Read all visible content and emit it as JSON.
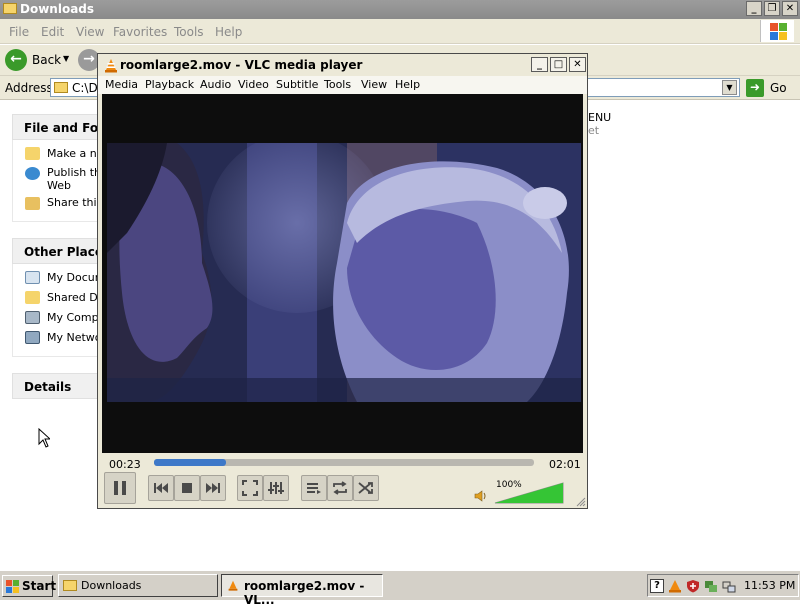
{
  "explorer": {
    "title": "Downloads",
    "menu": [
      "File",
      "Edit",
      "View",
      "Favorites",
      "Tools",
      "Help"
    ],
    "toolbar": {
      "back_label": "Back"
    },
    "address": {
      "label": "Address",
      "value": "C:\\Do",
      "go_label": "Go"
    },
    "task_pane": {
      "file_folder_tasks": {
        "header": "File and Folde",
        "items": [
          "Make a ne",
          "Publish thi",
          "Web",
          "Share this"
        ]
      },
      "other_places": {
        "header": "Other Places",
        "items": [
          "My Docum",
          "Shared Do",
          "My Compu",
          "My Netwo"
        ]
      },
      "details": {
        "header": "Details"
      }
    },
    "right_fragments": [
      "ENU",
      "et"
    ]
  },
  "vlc": {
    "title": "roomlarge2.mov - VLC media player",
    "menu": [
      "Media",
      "Playback",
      "Audio",
      "Video",
      "Subtitle",
      "Tools",
      "View",
      "Help"
    ],
    "time_current": "00:23",
    "time_total": "02:01",
    "progress": 0.19,
    "volume_label": "100%",
    "volume_level": 1.0,
    "accent_color": "#3d78c8",
    "volume_color": "#35c535"
  },
  "taskbar": {
    "start_label": "Start",
    "tasks": [
      {
        "label": "Downloads",
        "active": false
      },
      {
        "label": "roomlarge2.mov - VL...",
        "active": true
      }
    ],
    "clock": "11:53 PM"
  }
}
